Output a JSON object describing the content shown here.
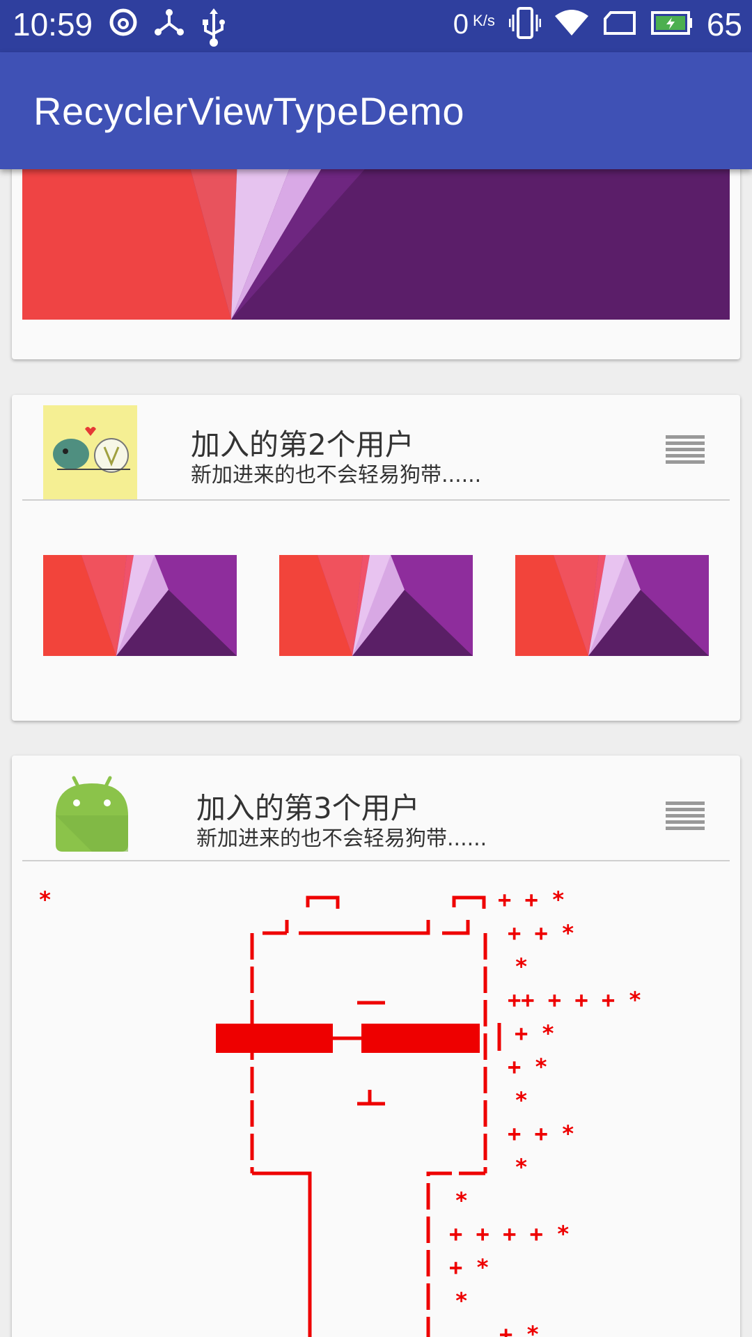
{
  "status_bar": {
    "time": "10:59",
    "net_speed": "0",
    "net_unit": "K/s",
    "battery": "65",
    "icons": [
      "netease-music-icon",
      "share-hub-icon",
      "usb-icon",
      "vibrate-icon",
      "wifi-icon",
      "sim-icon",
      "battery-charging-icon"
    ]
  },
  "app_bar": {
    "title": "RecyclerViewTypeDemo"
  },
  "cards": [
    {
      "type": "banner"
    },
    {
      "type": "user_with_images",
      "name": "加入的第2个用户",
      "desc": "新加进来的也不会轻易狗带......",
      "thumbnail_count": 3
    },
    {
      "type": "user_with_ascii",
      "name": "加入的第3个用户",
      "desc": "新加进来的也不会轻易狗带......"
    }
  ],
  "colors": {
    "status_bar": "#2f3f9e",
    "app_bar": "#3f51b5",
    "ascii_art": "#ee0000",
    "android_green": "#8bc34a"
  }
}
